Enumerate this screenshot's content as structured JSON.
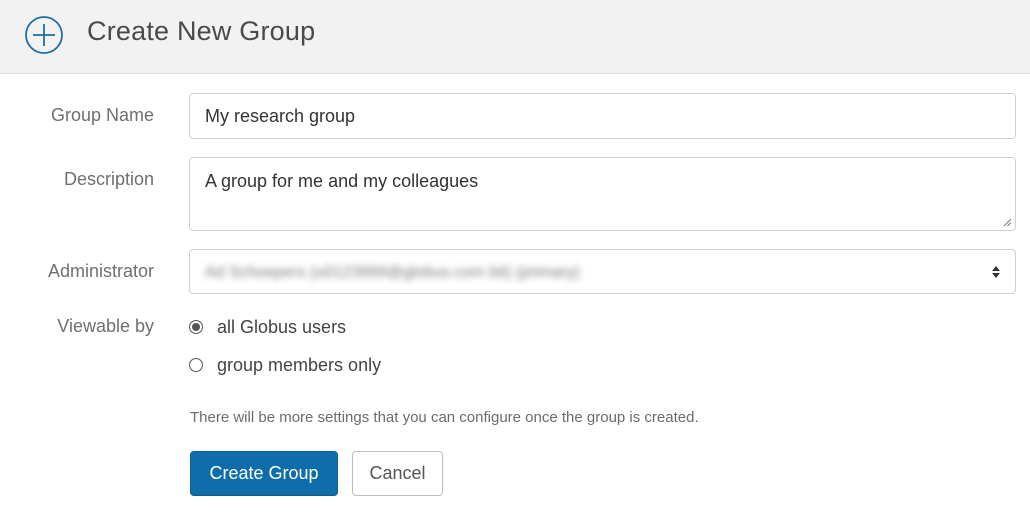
{
  "header": {
    "title": "Create New Group",
    "icon": "plus-circle-icon",
    "icon_color": "#1d6fa5"
  },
  "form": {
    "group_name": {
      "label": "Group Name",
      "value": "My research group"
    },
    "description": {
      "label": "Description",
      "value": "A group for me and my colleagues"
    },
    "administrator": {
      "label": "Administrator",
      "value": "Ad Schoepers (u0123999@globus.com bit) (primary)"
    },
    "viewable_by": {
      "label": "Viewable by",
      "options": [
        {
          "label": "all Globus users",
          "selected": true
        },
        {
          "label": "group members only",
          "selected": false
        }
      ]
    },
    "hint": "There will be more settings that you can configure once the group is created.",
    "buttons": {
      "create": "Create Group",
      "cancel": "Cancel"
    }
  },
  "colors": {
    "primary_button": "#0f6ea9",
    "header_bg": "#f2f2f2"
  }
}
